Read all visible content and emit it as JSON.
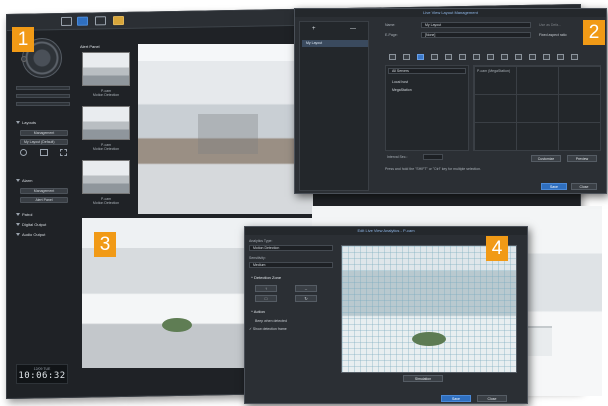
{
  "badges": [
    "1",
    "2",
    "3",
    "4"
  ],
  "sidebar": {
    "sections": [
      {
        "label": "Layouts",
        "items": [
          "Management",
          "My Layout (Default)"
        ]
      },
      {
        "label": "Alarm",
        "items": [
          "Management",
          "Alert Panel"
        ]
      },
      {
        "label": "Patrol",
        "items": []
      },
      {
        "label": "Digital Output",
        "items": []
      },
      {
        "label": "Audio Output",
        "items": []
      }
    ],
    "clock": {
      "date": "12/09 TUE",
      "time": "10:06:32"
    }
  },
  "alerts": {
    "header": "Alert Panel",
    "items": [
      {
        "name": "P-cam",
        "event": "Motion Detection"
      },
      {
        "name": "P-cam",
        "event": "Motion Detection"
      },
      {
        "name": "P-cam",
        "event": "Motion Detection"
      }
    ]
  },
  "layout_dialog": {
    "title": "Live View Layout Management",
    "add": "+",
    "remove": "—",
    "list": [
      "My Layout"
    ],
    "name_label": "Name:",
    "name_value": "My Layout",
    "epage_label": "E-Page:",
    "epage_value": "[None]",
    "check_all": "Use as Defa...",
    "check_fixed": "Fixed aspect ratio",
    "servers_label": "All Servers",
    "tree": [
      "Local host",
      "MegaStation"
    ],
    "cell_label": "P-cam (MegaStation)",
    "interval_label": "Interval Sec.:",
    "hint": "Press and hold the \"SHIFT\" or \"Ctrl\" key for multiple selection.",
    "customize": "Customize",
    "preview": "Preview",
    "save": "Save",
    "close": "Close"
  },
  "analytics_dialog": {
    "title": "Edit Live View Analytics - P-cam",
    "type_label": "Analytics Type:",
    "type_value": "Motion Detection",
    "sens_label": "Sensitivity:",
    "sens_value": "Medium",
    "zone_label": "Detection Zone",
    "action_label": "Action",
    "beep": "Beep when detected",
    "show": "Show detection frame",
    "simulation": "Simulation",
    "save": "Save",
    "close": "Close"
  }
}
